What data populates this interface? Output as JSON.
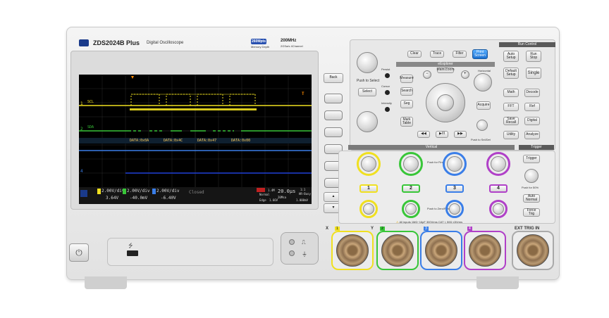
{
  "device": {
    "model": "ZDS2024B Plus",
    "subtitle": "Digital Oscilloscope",
    "memory_badge": "260Mpts",
    "memory_label": "Memory Depth",
    "bandwidth": "200MHz",
    "sample_info": "2GSa/s 4Channel"
  },
  "side_buttons": {
    "back": "Back"
  },
  "top_buttons": {
    "clear": "Clear",
    "trace": "Trace",
    "filter": "Filter",
    "print_screen": "Print Screen"
  },
  "left_controls": {
    "push_select": "Push to Select",
    "select": "Select",
    "persist": "Persist",
    "cursor": "Cursor",
    "intensity": "Intensity"
  },
  "explorer": {
    "title": "eExplorer",
    "measure": "Measure",
    "search": "Search",
    "seg": "Seg",
    "mark_table": "Mark Table",
    "main_zoom": "Main/Zoom",
    "navigate": "Navigate",
    "acquire": "Acquire",
    "horizontal": "Horizontal",
    "push_seldet": "Push to Sel/Det",
    "push_help": "Push to Go/Help",
    "prev": "◀◀",
    "play": "▶/II",
    "next": "▶▶"
  },
  "run_control": {
    "title": "Run Control",
    "auto_setup": "Auto Setup",
    "run_stop": "Run Stop",
    "default_setup": "Default Setup",
    "single": "Single",
    "math": "Math",
    "decode": "Decode",
    "fft": "FFT",
    "ref": "Ref",
    "save_recall": "Save Recall",
    "digital": "Digital",
    "utility": "Utility",
    "analyze": "Analyze"
  },
  "vertical": {
    "title": "Vertical",
    "channels": [
      "1",
      "2",
      "3",
      "4"
    ],
    "push_fine": "Push for Fine",
    "push_zero": "Push to Zero/Return",
    "colors": [
      "#f0e020",
      "#38c638",
      "#3a7ee8",
      "#b040c8"
    ]
  },
  "trigger": {
    "title": "Trigger",
    "trigger": "Trigger",
    "push_50": "Push for 50%",
    "auto_normal": "Auto Normal",
    "force_trig": "Force Trig"
  },
  "inputs": {
    "warning": "All inputs 1MΩ~16pF 300Vrms CAT I, 50Ω ≤5Vrms",
    "ext_trig": "EXT TRIG IN",
    "x_label": "X",
    "y_label": "Y",
    "channel_numbers": [
      "1",
      "2",
      "3",
      "4"
    ]
  },
  "screen": {
    "trigger_marker": "T",
    "ch1_label": "1",
    "ch2_label": "2",
    "ch4_label": "4",
    "decode_label_top": "SCL",
    "decode_label_bottom": "SDA",
    "decode_labels": [
      "DATA:0x0A",
      "DATA:0x4C",
      "DATA:0x47",
      "DATA:0x00"
    ],
    "status": {
      "ch1_scale": "2.00V/div",
      "ch1_offset": "3.64V",
      "ch2_scale": "2.00V/div",
      "ch2_offset": "-40.0mV",
      "ch3_scale": "2.00V/div",
      "ch3_offset": "-6.40V",
      "ch4_state": "Closed",
      "acq_mode": "Normal",
      "acq_points": "1.4M",
      "trigger_mode": "Edge",
      "timebase": "20.0μs",
      "sample_rate": "20Msa",
      "trig_level": "1.66V",
      "extra": "1:1",
      "hr_label": "HR-Busy",
      "mem": "1.000mV"
    }
  },
  "power": {
    "icon": "power-icon"
  },
  "usb": {
    "icon": "usb-icon"
  }
}
